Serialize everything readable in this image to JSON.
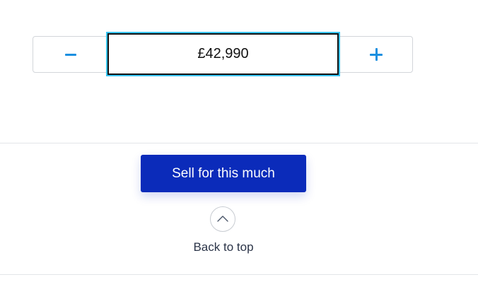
{
  "stepper": {
    "value": "£42,990",
    "minus_icon": "minus-icon",
    "plus_icon": "plus-icon"
  },
  "actions": {
    "sell_label": "Sell for this much"
  },
  "back_to_top": {
    "label": "Back to top",
    "icon": "chevron-up-icon"
  },
  "colors": {
    "primary_button": "#0b2bba",
    "stepper_icon": "#1a8fe0",
    "focus_ring": "#38c4f2"
  }
}
